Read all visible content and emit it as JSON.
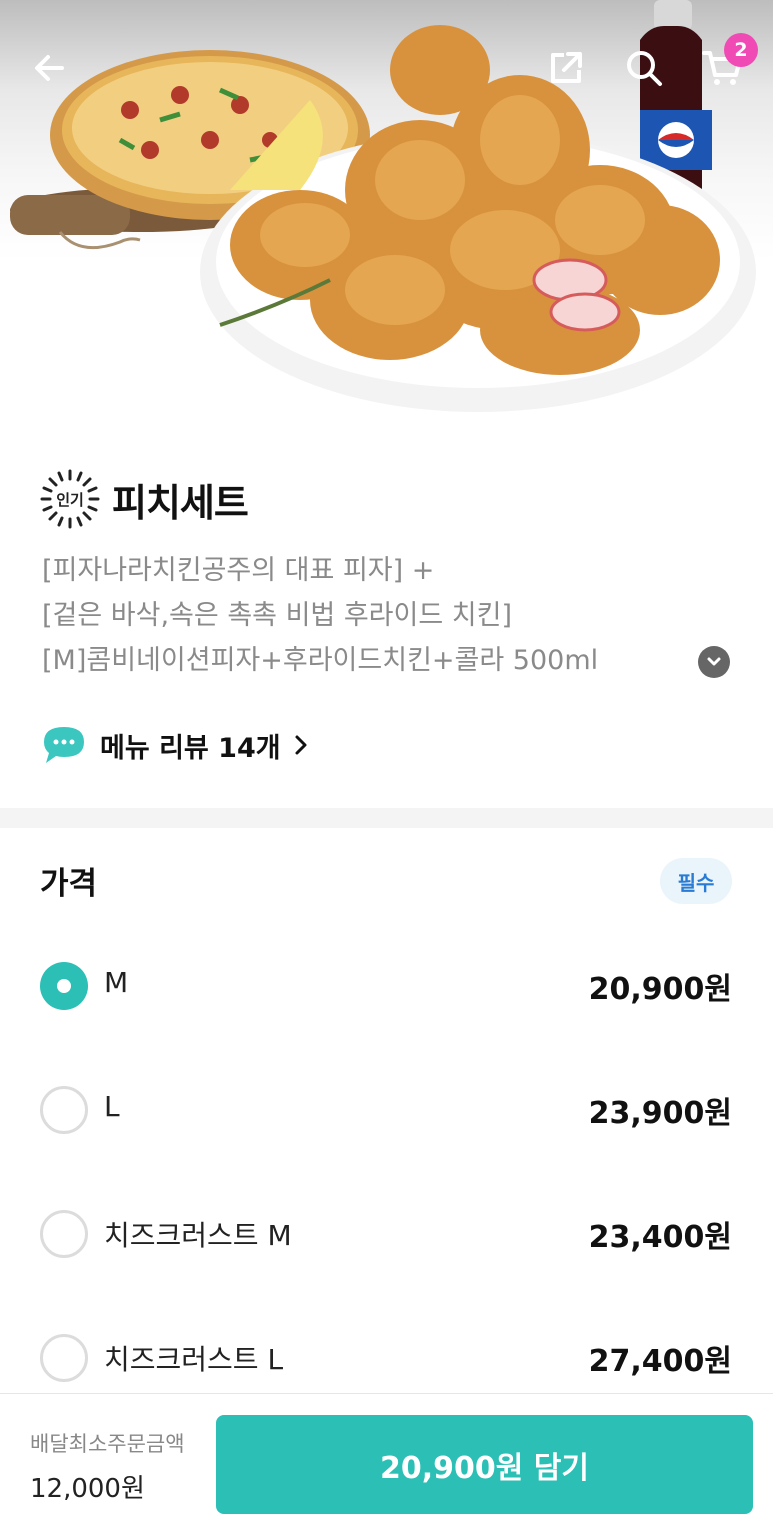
{
  "header": {
    "back_icon": "arrow-left-icon",
    "share_icon": "share-icon",
    "search_icon": "search-icon",
    "cart_icon": "cart-icon",
    "cart_count": "2"
  },
  "hero": {
    "image_desc_icon": "food-photo"
  },
  "menu": {
    "badge": "인기",
    "title": "피치세트",
    "description_lines": [
      "[피자나라치킨공주의 대표 피자] +",
      "[겉은 바삭,속은 촉촉 비법 후라이드 치킨]",
      "[M]콤비네이션피자+후라이드치킨+콜라 500ml"
    ],
    "review_label": "메뉴 리뷰 14개"
  },
  "price_section": {
    "title": "가격",
    "required_label": "필수",
    "options": [
      {
        "label": "M",
        "price": "20,900원",
        "selected": true
      },
      {
        "label": "L",
        "price": "23,900원",
        "selected": false
      },
      {
        "label": "치즈크러스트 M",
        "price": "23,400원",
        "selected": false
      },
      {
        "label": "치즈크러스트 L",
        "price": "27,400원",
        "selected": false
      }
    ]
  },
  "bottom_bar": {
    "min_order_label": "배달최소주문금액",
    "min_order_value": "12,000원",
    "add_button_label": "20,900원 담기"
  },
  "colors": {
    "accent": "#2bbfb5",
    "badge_pink": "#f04bb5",
    "required_blue": "#2a7bd3"
  }
}
